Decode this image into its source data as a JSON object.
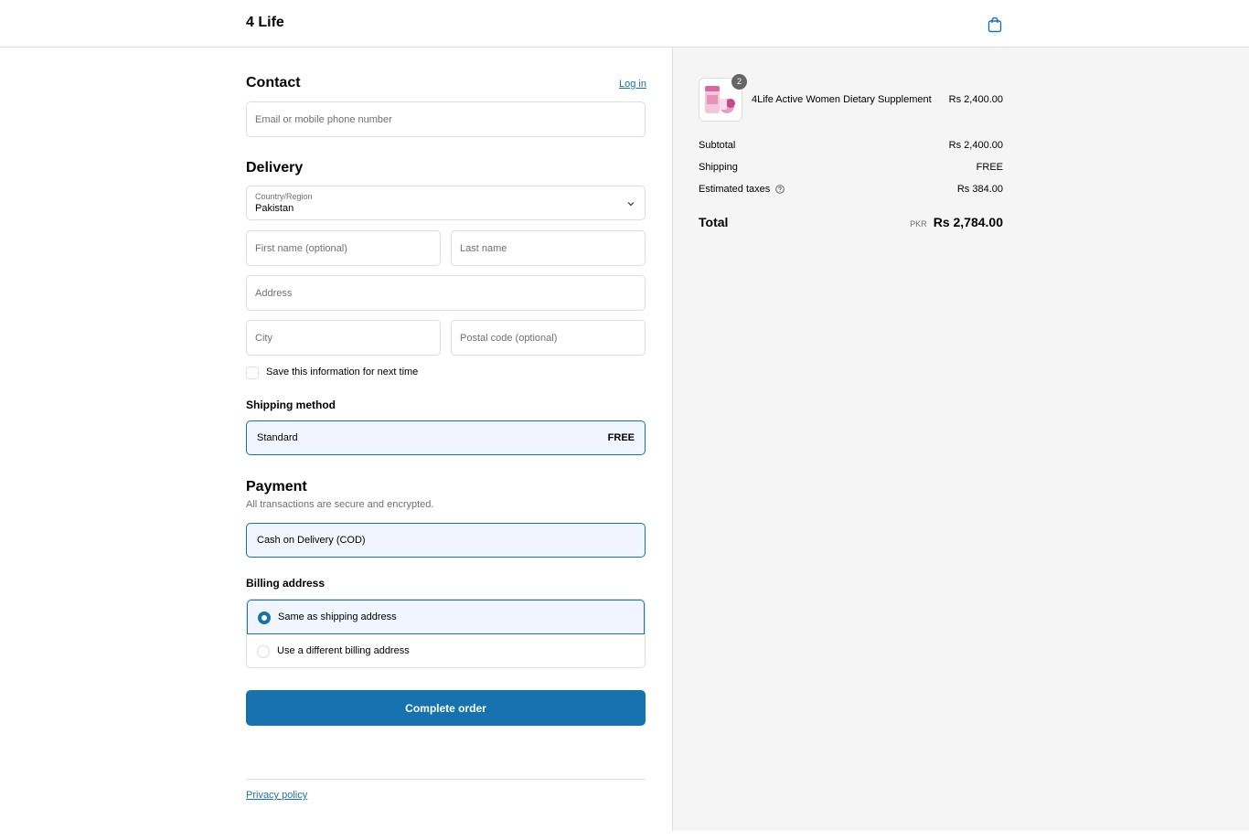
{
  "header": {
    "brand": "4 Life",
    "cart_icon": "shopping-bag-icon"
  },
  "contact": {
    "title": "Contact",
    "login_link": "Log in",
    "email_placeholder": "Email or mobile phone number"
  },
  "delivery": {
    "title": "Delivery",
    "country_label": "Country/Region",
    "country_value": "Pakistan",
    "first_name_placeholder": "First name (optional)",
    "last_name_placeholder": "Last name",
    "address_placeholder": "Address",
    "city_placeholder": "City",
    "postal_placeholder": "Postal code (optional)",
    "save_info_label": "Save this information for next time"
  },
  "shipping": {
    "title": "Shipping method",
    "method": "Standard",
    "price": "FREE"
  },
  "payment": {
    "title": "Payment",
    "subtitle": "All transactions are secure and encrypted.",
    "method": "Cash on Delivery (COD)"
  },
  "billing": {
    "title": "Billing address",
    "options": [
      {
        "label": "Same as shipping address",
        "selected": true
      },
      {
        "label": "Use a different billing address",
        "selected": false
      }
    ]
  },
  "actions": {
    "complete_order": "Complete order"
  },
  "footer": {
    "privacy_policy": "Privacy policy"
  },
  "order_summary": {
    "item": {
      "name": "4Life Active Women Dietary Supplement",
      "price": "Rs 2,400.00",
      "quantity": "2"
    },
    "subtotal_label": "Subtotal",
    "subtotal_value": "Rs 2,400.00",
    "shipping_label": "Shipping",
    "shipping_value": "FREE",
    "taxes_label": "Estimated taxes",
    "taxes_value": "Rs 384.00",
    "total_label": "Total",
    "currency": "PKR",
    "total_value": "Rs 2,784.00"
  },
  "colors": {
    "accent": "#1773b0",
    "selected_bg": "#f0f5ff",
    "summary_bg": "#f5f5f5",
    "border": "#dedede"
  }
}
